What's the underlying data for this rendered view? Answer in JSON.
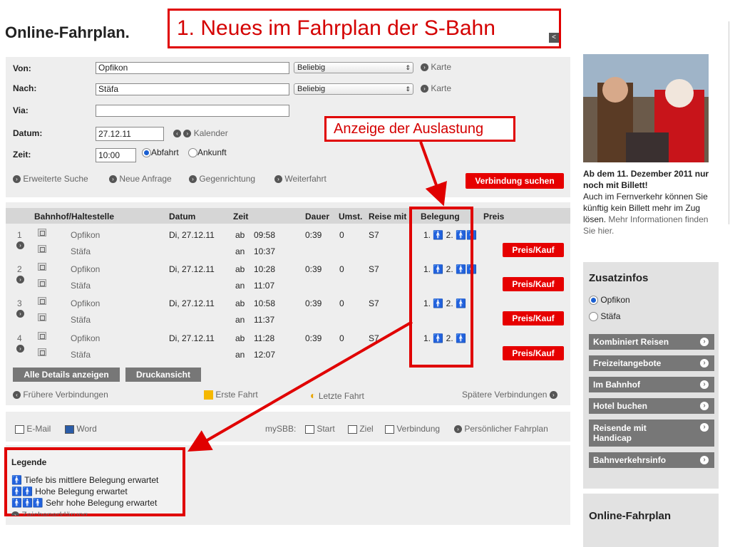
{
  "header": {
    "title": "Online-Fahrplan.",
    "callout_title": "1. Neues im Fahrplan der S-Bahn",
    "callout_occupancy": "Anzeige der Auslastung"
  },
  "form": {
    "von_label": "Von:",
    "von_value": "Opfikon",
    "nach_label": "Nach:",
    "nach_value": "Stäfa",
    "via_label": "Via:",
    "via_value": "",
    "datum_label": "Datum:",
    "datum_value": "27.12.11",
    "zeit_label": "Zeit:",
    "zeit_value": "10:00",
    "select_from": "Beliebig",
    "select_to": "Beliebig",
    "karte": "Karte",
    "kalender": "Kalender",
    "abfahrt": "Abfahrt",
    "ankunft": "Ankunft",
    "links": [
      "Erweiterte Suche",
      "Neue Anfrage",
      "Gegenrichtung",
      "Weiterfahrt"
    ],
    "search_button": "Verbindung suchen"
  },
  "table": {
    "headers": [
      "Bahnhof/Haltestelle",
      "Datum",
      "Zeit",
      "Dauer",
      "Umst.",
      "Reise mit",
      "Belegung",
      "Preis"
    ],
    "rows": [
      {
        "nr": "1",
        "from": "Opfikon",
        "to": "Stäfa",
        "date": "Di, 27.12.11",
        "dep_tag": "ab",
        "dep": "09:58",
        "arr_tag": "an",
        "arr": "10:37",
        "dauer": "0:39",
        "umst": "0",
        "reise": "S7",
        "c1": "1.",
        "c2": "2."
      },
      {
        "nr": "2",
        "from": "Opfikon",
        "to": "Stäfa",
        "date": "Di, 27.12.11",
        "dep_tag": "ab",
        "dep": "10:28",
        "arr_tag": "an",
        "arr": "11:07",
        "dauer": "0:39",
        "umst": "0",
        "reise": "S7",
        "c1": "1.",
        "c2": "2."
      },
      {
        "nr": "3",
        "from": "Opfikon",
        "to": "Stäfa",
        "date": "Di, 27.12.11",
        "dep_tag": "ab",
        "dep": "10:58",
        "arr_tag": "an",
        "arr": "11:37",
        "dauer": "0:39",
        "umst": "0",
        "reise": "S7",
        "c1": "1.",
        "c2": "2."
      },
      {
        "nr": "4",
        "from": "Opfikon",
        "to": "Stäfa",
        "date": "Di, 27.12.11",
        "dep_tag": "ab",
        "dep": "11:28",
        "arr_tag": "an",
        "arr": "12:07",
        "dauer": "0:39",
        "umst": "0",
        "reise": "S7",
        "c1": "1.",
        "c2": "2."
      }
    ],
    "buy_button": "Preis/Kauf",
    "details_button": "Alle Details anzeigen",
    "print_button": "Druckansicht",
    "earlier": "Frühere Verbindungen",
    "first": "Erste Fahrt",
    "last": "Letzte Fahrt",
    "later": "Spätere Verbindungen"
  },
  "tools": {
    "email": "E-Mail",
    "word": "Word",
    "mysbb": "mySBB:",
    "start": "Start",
    "ziel": "Ziel",
    "verbindung": "Verbindung",
    "personal": "Persönlicher Fahrplan"
  },
  "legend": {
    "title": "Legende",
    "low": "Tiefe bis mittlere Belegung erwartet",
    "high": "Hohe Belegung erwartet",
    "very_high": "Sehr hohe Belegung erwartet",
    "cut_text": "Zeichenerklärung"
  },
  "promo": {
    "headline": "Ab dem 11. Dezember 2011 nur noch mit Billett!",
    "body": "Auch im Fernverkehr können Sie künftig kein Billett mehr im Zug lösen.",
    "link": "Mehr Informationen finden Sie hier."
  },
  "sidebar": {
    "title": "Zusatzinfos",
    "radio_1": "Opfikon",
    "radio_2": "Stäfa",
    "buttons": [
      "Kombiniert Reisen",
      "Freizeitangebote",
      "Im Bahnhof",
      "Hotel buchen",
      "Reisende mit Handicap",
      "Bahnverkehrsinfo"
    ],
    "bottom_title": "Online-Fahrplan"
  }
}
